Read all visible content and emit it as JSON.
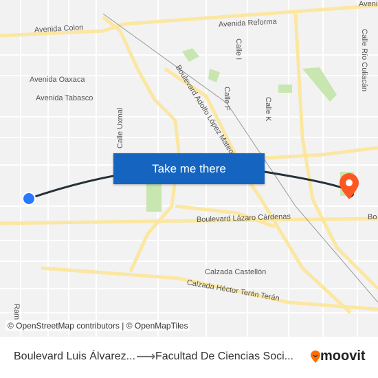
{
  "map": {
    "labels": {
      "avenida_colon": "Avenida Colon",
      "avenida_reforma": "Avenida Reforma",
      "avenida_top_right": "Aveni",
      "avenida_oaxaca": "Avenida Oaxaca",
      "avenida_tabasco": "Avenida Tabasco",
      "calle_uxmal": "Calle Uxmal",
      "blvd_lopez_mateos": "Boulevard Adolfo López Mateos",
      "calle_i": "Calle I",
      "calle_f": "Calle F",
      "calle_k": "Calle K",
      "calle_rio_culiacan": "Calle Río Culiacán",
      "blvd_lazaro_cardenas": "Boulevard Lázaro Cárdenas",
      "bo_right": "Bo",
      "calzada_castellon": "Calzada Castellón",
      "calzada_hector_teran": "Calzada Héctor Terán Terán",
      "ram_left": "Ram"
    },
    "colors": {
      "origin": "#2979ff",
      "destination": "#ff5722",
      "route": "#263238",
      "road_major": "#fbe7a1",
      "park": "#c8e6b0",
      "button": "#1565c0"
    },
    "attribution": "© OpenStreetMap contributors | © OpenMapTiles"
  },
  "cta": {
    "label": "Take me there"
  },
  "footer": {
    "from": "Boulevard Luis Álvarez...",
    "arrow": "⟶",
    "to": "Facultad De Ciencias Soci...",
    "brand": "moovit"
  }
}
